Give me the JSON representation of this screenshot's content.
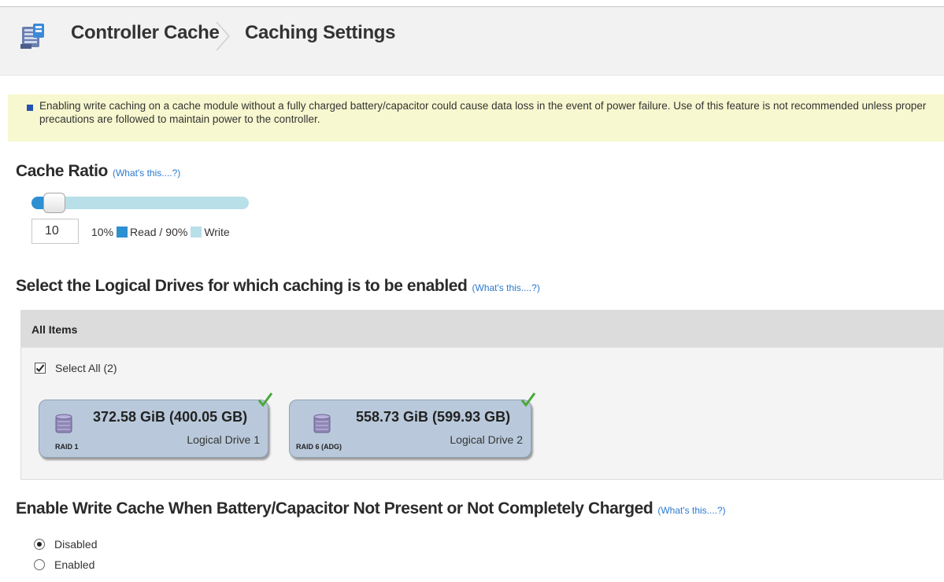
{
  "header": {
    "breadcrumb_parent": "Controller Cache",
    "breadcrumb_current": "Caching Settings"
  },
  "alert": {
    "text": "Enabling write caching on a cache module without a fully charged battery/capacitor could cause data loss in the event of power failure. Use of this feature is not recommended unless proper precautions are followed to maintain power to the controller."
  },
  "cache_ratio": {
    "title": "Cache Ratio",
    "help_link": "(What's this....?)",
    "value": "10",
    "read_percent": 10,
    "read_label": "10%",
    "read_text": "Read /",
    "write_label": "90%",
    "write_text": "Write",
    "read_color": "#2e8fd1",
    "write_color": "#b9dfe9"
  },
  "logical_drives": {
    "title": "Select the Logical Drives for which caching is to be enabled",
    "help_link": "(What's this....?)",
    "panel_header": "All Items",
    "select_all_label": "Select All (2)",
    "select_all_checked": true,
    "items": [
      {
        "size": "372.58 GiB (400.05 GB)",
        "name": "Logical Drive 1",
        "raid": "RAID 1",
        "selected": true,
        "icon": "disk-drive-icon"
      },
      {
        "size": "558.73 GiB (599.93 GB)",
        "name": "Logical Drive 2",
        "raid": "RAID 6 (ADG)",
        "selected": true,
        "icon": "disk-drive-icon"
      }
    ]
  },
  "write_cache": {
    "title": "Enable Write Cache When Battery/Capacitor Not Present or Not Completely Charged",
    "help_link": "(What's this....?)",
    "options": [
      "Disabled",
      "Enabled"
    ],
    "selected": "Disabled"
  },
  "icons": {
    "app": "controller-cache-icon",
    "breadcrumb_separator": "chevron-right-icon",
    "alert": "info-bullet-icon",
    "check": "checkmark-icon"
  }
}
